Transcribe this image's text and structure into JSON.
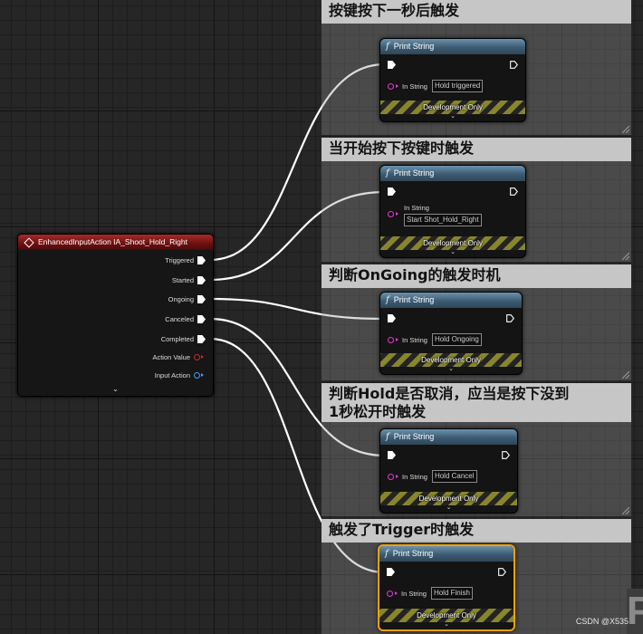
{
  "event_node": {
    "title": "EnhancedInputAction IA_Shoot_Hold_Right",
    "pins": [
      "Triggered",
      "Started",
      "Ongoing",
      "Canceled",
      "Completed"
    ],
    "action_value_label": "Action Value",
    "input_action_label": "Input Action"
  },
  "comments": [
    {
      "text": "按键按下一秒后触发"
    },
    {
      "text": "当开始按下按键时触发"
    },
    {
      "text": "判断OnGoing的触发时机"
    },
    {
      "text": "判断Hold是否取消，应当是按下没到1秒松开时触发"
    },
    {
      "text": "触发了Trigger时触发"
    }
  ],
  "print_nodes": [
    {
      "title": "Print String",
      "in_string_label": "In String",
      "value": "Hold  triggered",
      "footer": "Development Only"
    },
    {
      "title": "Print String",
      "in_string_label": "In String",
      "value": "Start Shot_Hold_Right",
      "footer": "Development Only"
    },
    {
      "title": "Print String",
      "in_string_label": "In String",
      "value": "Hold Ongoing",
      "footer": "Development Only"
    },
    {
      "title": "Print String",
      "in_string_label": "In String",
      "value": "Hold Cancel",
      "footer": "Development Only"
    },
    {
      "title": "Print String",
      "in_string_label": "In String",
      "value": "Hold Finish",
      "footer": "Development Only"
    }
  ],
  "watermark": "CSDN @X535",
  "colors": {
    "event_header": "#8b1a1a",
    "function_header": "#4a6f8a",
    "selected_outline": "#f2a100",
    "string_pin": "#e23ad1",
    "action_value_pin": "#d12828",
    "input_action_pin": "#3aa1ff"
  },
  "icons": {
    "event": "event-diamond-icon",
    "function": "function-f-icon",
    "exec": "exec-pin-icon",
    "expand": "chevron-down-icon"
  }
}
